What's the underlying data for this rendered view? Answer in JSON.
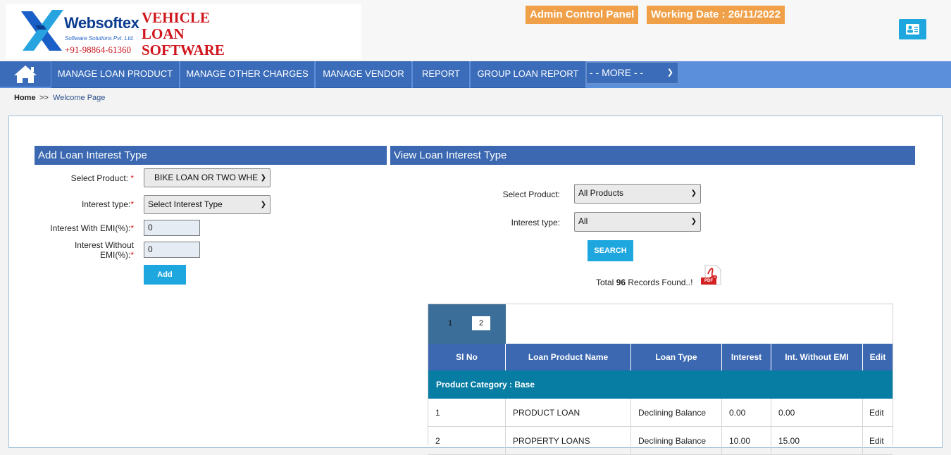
{
  "header": {
    "brand": "Websoftex",
    "brand_sub": "Software Solutions Pvt. Ltd.",
    "phone": "+91-98864-61360",
    "app_title_lines": [
      "VEHICLE",
      "LOAN",
      "SOFTWARE"
    ],
    "admin_panel": "Admin Control Panel",
    "working_date": "Working Date : 26/11/2022"
  },
  "nav": {
    "items": [
      "MANAGE LOAN PRODUCT",
      "MANAGE OTHER CHARGES",
      "MANAGE VENDOR",
      "REPORT",
      "GROUP LOAN REPORT"
    ],
    "more": "- - MORE - -"
  },
  "breadcrumb": {
    "home": "Home",
    "sep": ">>",
    "page": "Welcome Page"
  },
  "add_form": {
    "title": "Add Loan Interest Type",
    "product_label": "Select Product:",
    "product_value": "BIKE LOAN OR TWO WHE",
    "interest_type_label": "Interest type:",
    "interest_type_value": "Select Interest Type",
    "emi_label": "Interest With EMI(%):",
    "emi_value": "0",
    "no_emi_label_1": "Interest Without",
    "no_emi_label_2": "EMI(%):",
    "no_emi_value": "0",
    "add_button": "Add",
    "required_mark": "*"
  },
  "view_form": {
    "title": "View Loan Interest Type",
    "product_label": "Select Product:",
    "product_value": "All Products",
    "interest_type_label": "Interest type:",
    "interest_type_value": "All",
    "search_button": "SEARCH",
    "records_prefix": "Total ",
    "records_count": "96",
    "records_suffix": " Records Found..!",
    "pdf_label": "PDF"
  },
  "table": {
    "pages": [
      "1",
      "2"
    ],
    "columns": [
      "Sl No",
      "Loan Product Name",
      "Loan Type",
      "Interest",
      "Int. Without EMI",
      "Edit"
    ],
    "category": "Product Category : Base",
    "rows": [
      [
        "1",
        "PRODUCT LOAN",
        "Declining Balance",
        "0.00",
        "0.00",
        "Edit"
      ],
      [
        "2",
        "PROPERTY LOANS",
        "Declining Balance",
        "10.00",
        "15.00",
        "Edit"
      ]
    ]
  },
  "colors": {
    "nav": "#3a6cb9",
    "accent": "#1ea7df",
    "badge": "#f0a048",
    "category": "#077da4"
  }
}
